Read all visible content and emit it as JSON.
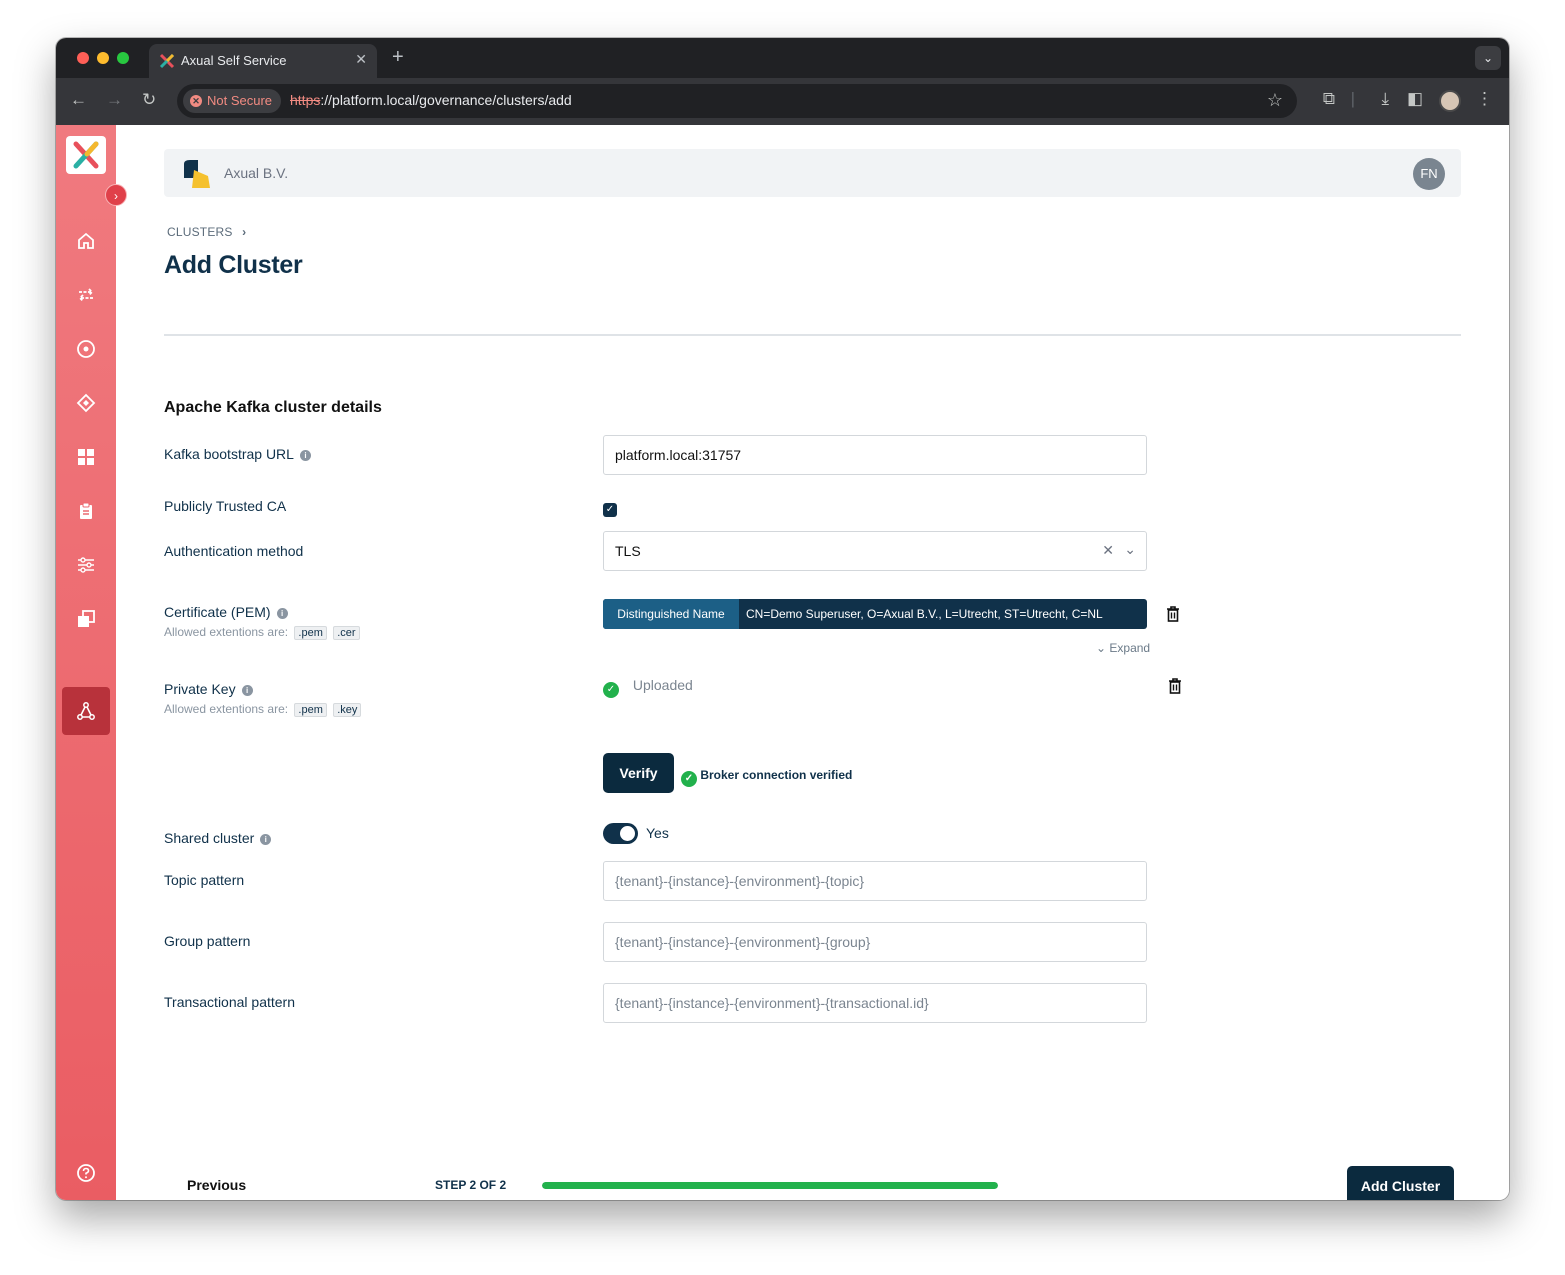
{
  "browser": {
    "tab_title": "Axual Self Service",
    "tab_close": "✕",
    "new_tab": "+",
    "security_label": "Not Secure",
    "url_scheme": "https",
    "url_rest": "://platform.local/governance/clusters/add"
  },
  "header": {
    "org_name": "Axual B.V.",
    "user_initials": "FN"
  },
  "breadcrumb": {
    "item": "CLUSTERS",
    "separator": "›"
  },
  "page": {
    "title": "Add Cluster",
    "section_title": "Apache Kafka cluster details"
  },
  "form": {
    "bootstrap": {
      "label": "Kafka bootstrap URL",
      "value": "platform.local:31757"
    },
    "trusted_ca": {
      "label": "Publicly Trusted CA",
      "checked": true
    },
    "auth": {
      "label": "Authentication method",
      "value": "TLS"
    },
    "certificate": {
      "label": "Certificate (PEM)",
      "hint": "Allowed extentions are:",
      "ext1": ".pem",
      "ext2": ".cer",
      "dn_label": "Distinguished Name",
      "dn_value": "CN=Demo Superuser, O=Axual B.V., L=Utrecht, ST=Utrecht, C=NL",
      "expand_label": "Expand"
    },
    "private_key": {
      "label": "Private Key",
      "hint": "Allowed extentions are:",
      "ext1": ".pem",
      "ext2": ".key",
      "status": "Uploaded"
    },
    "verify": {
      "button": "Verify",
      "status": "Broker connection verified"
    },
    "shared": {
      "label": "Shared cluster",
      "toggle_label": "Yes",
      "on": true
    },
    "topic_pattern": {
      "label": "Topic pattern",
      "placeholder": "{tenant}-{instance}-{environment}-{topic}"
    },
    "group_pattern": {
      "label": "Group pattern",
      "placeholder": "{tenant}-{instance}-{environment}-{group}"
    },
    "transactional_pattern": {
      "label": "Transactional pattern",
      "placeholder": "{tenant}-{instance}-{environment}-{transactional.id}"
    }
  },
  "footer": {
    "previous": "Previous",
    "step": "STEP 2 OF 2",
    "progress_fraction": 1.0,
    "submit": "Add Cluster"
  },
  "colors": {
    "sidebar_top": "#f07a7f",
    "sidebar_bottom": "#ea5d63",
    "primary": "#0b2a3e",
    "success": "#22b14c"
  }
}
